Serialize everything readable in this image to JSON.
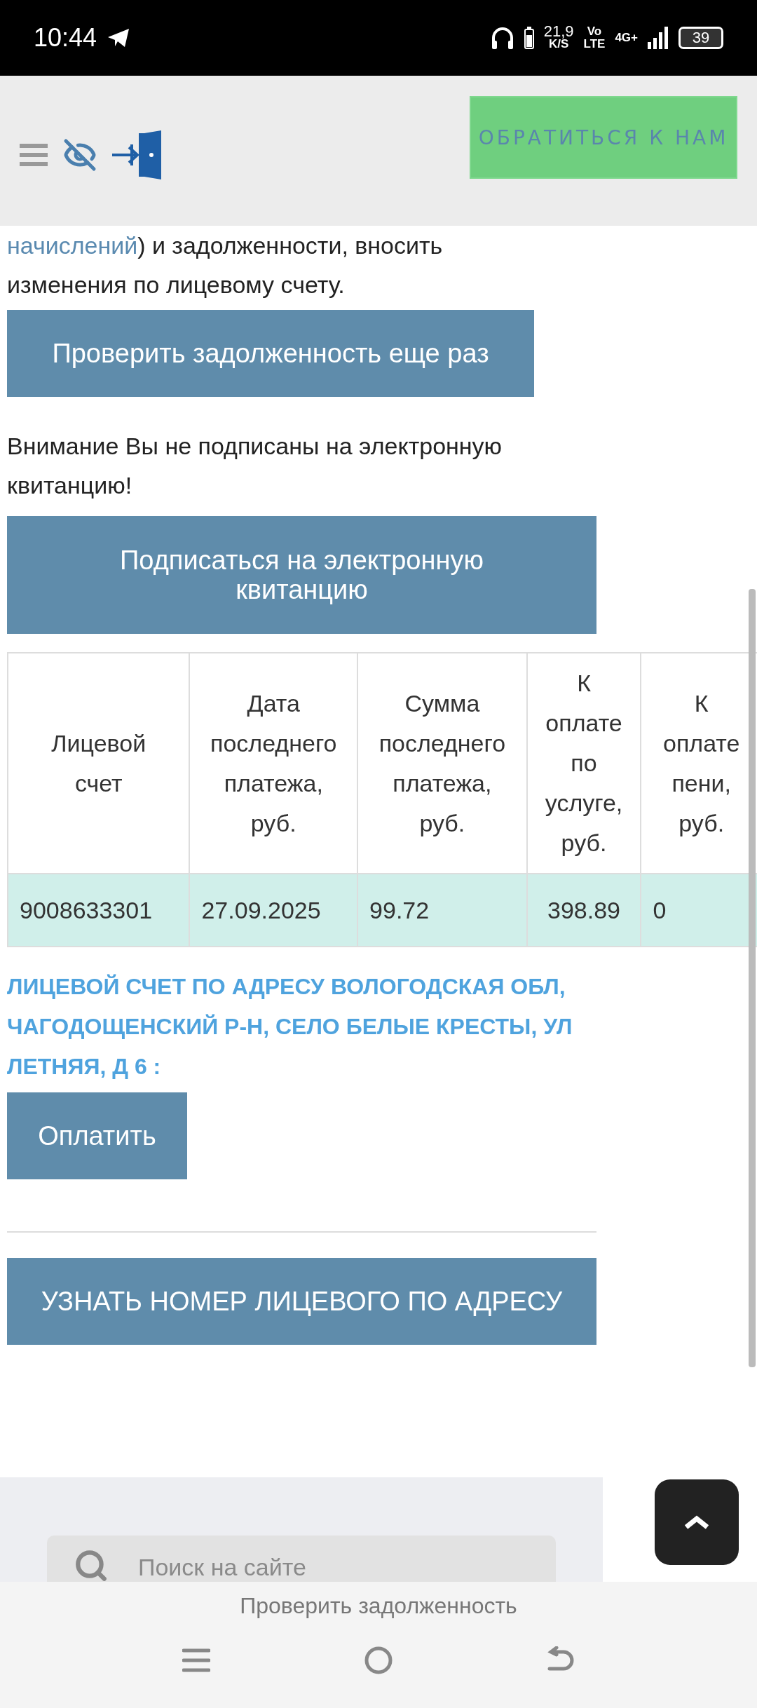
{
  "status_bar": {
    "time": "10:44",
    "speed": "21,9",
    "speed_unit": "K/S",
    "volte_top": "Vo",
    "volte_bottom": "LTE",
    "network_type": "4G+",
    "battery": "39"
  },
  "header": {
    "contact_button": "ОБРАТИТЬСЯ К НАМ"
  },
  "intro": {
    "link": "начислений",
    "line_1_rest": ") и задолженности, вносить",
    "line_2": "изменения по лицевому счету."
  },
  "recheck_button": "Проверить задолженность еще раз",
  "warning": "Внимание Вы не подписаны на электронную квитанцию!",
  "subscribe_button": "Подписаться на электронную квитанцию",
  "table": {
    "columns": [
      "Лицевой счет",
      "Дата последнего платежа, руб.",
      "Сумма последнего платежа, руб.",
      "К оплате по услуге, руб.",
      "К оплате пени, руб."
    ],
    "rows": [
      {
        "cells": [
          "9008633301",
          "27.09.2025",
          "99.72",
          "398.89",
          "0"
        ]
      }
    ]
  },
  "address_heading": "ЛИЦЕВОЙ СЧЕТ ПО АДРЕСУ ВОЛОГОДСКАЯ ОБЛ, ЧАГОДОЩЕНСКИЙ Р-Н, СЕЛО БЕЛЫЕ КРЕСТЫ, УЛ ЛЕТНЯЯ, Д 6 :",
  "pay_button": "Оплатить",
  "find_account_button": "УЗНАТЬ НОМЕР ЛИЦЕВОГО ПО АДРЕСУ",
  "search": {
    "placeholder": "Поиск на сайте"
  },
  "bottom_bar": {
    "title": "Проверить задолженность"
  }
}
